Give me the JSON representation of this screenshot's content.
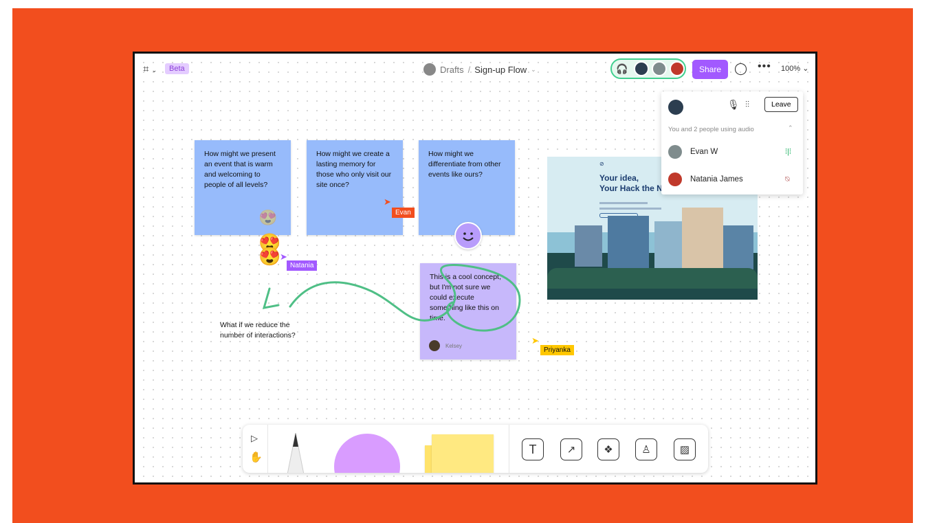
{
  "topbar": {
    "beta_label": "Beta",
    "breadcrumb_parent": "Drafts",
    "breadcrumb_separator": "/",
    "file_name": "Sign-up Flow",
    "share_label": "Share",
    "zoom": "100%"
  },
  "stickies": [
    {
      "text": "How might we present an event that is warm and welcoming to people of all levels?"
    },
    {
      "text": "How might we create a lasting memory for those who only visit our site once?"
    },
    {
      "text": "How might we differentiate from other events like ours?"
    }
  ],
  "comment_sticky": {
    "text": "This is a cool concept, but I'm not sure we could execute something like this on time.",
    "author": "Kelsey"
  },
  "freeform_text": "What if we reduce the number of interactions?",
  "cursors": [
    {
      "name": "Evan",
      "color": "#f24e1e"
    },
    {
      "name": "Natania",
      "color": "#a259ff"
    },
    {
      "name": "Priyanka",
      "color": "#ffc700"
    }
  ],
  "website_card": {
    "headline_line1": "Your idea,",
    "headline_line2": "Your Hack the No"
  },
  "audio_panel": {
    "leave_label": "Leave",
    "status": "You and 2 people using audio",
    "participants": [
      {
        "name": "Evan W",
        "audio": "speaking"
      },
      {
        "name": "Natania James",
        "audio": "muted"
      }
    ]
  },
  "colors": {
    "brand_orange": "#f24e1e",
    "accent_purple": "#a259ff",
    "sticky_blue": "#97bbfb",
    "sticky_purple": "#c7b8fb",
    "audio_green": "#14ae5c"
  },
  "icons": [
    "figma-menu-icon",
    "headphones-icon",
    "comment-icon",
    "more-icon",
    "mic-icon",
    "audio-settings-icon",
    "move-icon",
    "hand-icon",
    "pencil-icon",
    "text-icon",
    "connector-icon",
    "component-icon",
    "stamp-icon",
    "image-icon"
  ]
}
